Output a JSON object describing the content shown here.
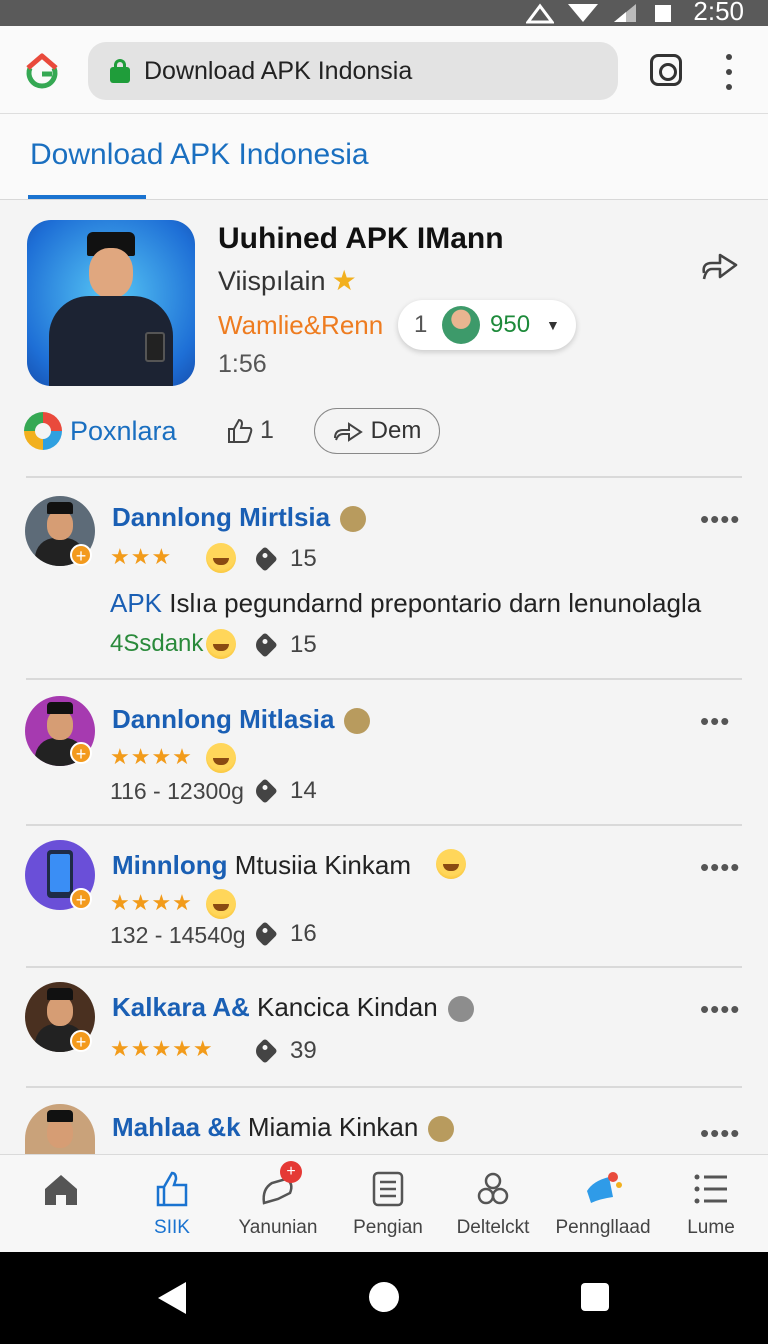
{
  "status_bar": {
    "time": "2:50"
  },
  "browser": {
    "url_title": "Download APK Indonsia"
  },
  "site": {
    "title": "Download APK Indonesia"
  },
  "app": {
    "name": "Uuhined APK IMann",
    "subtitle": "Viispılain",
    "developer": "Wamlie&Renn",
    "time": "1:56",
    "count_left": "1",
    "count_right": "950",
    "source_label": "Poxnlara",
    "like_count": "1",
    "dem_label": "Dem"
  },
  "reviews": [
    {
      "name": "Dannlong Mirtlsia",
      "stars": "★★★",
      "tag_count": "15",
      "text_prefix": "APK",
      "text": " Islıa pegundarnd prepontario darn lenunolagla",
      "green_text": "4Ssdank",
      "green_count": "15",
      "more": "••••"
    },
    {
      "name": "Dannlong Mitlasia",
      "stars": "★★★★",
      "meta": "116 - 12300g",
      "tag_count": "14",
      "more": "•••"
    },
    {
      "name_bold": "Minnlong",
      "name_plain": " Mtusiia Kinkam",
      "stars": "★★★★",
      "meta": "132 - 14540g",
      "tag_count": "16",
      "more": "••••"
    },
    {
      "name_bold": "Kalkara A&",
      "name_plain": " Kancica Kindan",
      "stars": "★★★★★",
      "tag_count": "39",
      "more": "••••"
    },
    {
      "name_bold": "Mahlaa &k",
      "name_plain": " Miamia Kinkan",
      "more": "••••"
    }
  ],
  "bottom_nav": [
    {
      "label": "",
      "icon": "home-icon"
    },
    {
      "label": "SIIK",
      "icon": "thumbs-up-icon",
      "active": true
    },
    {
      "label": "Yanunian",
      "icon": "chat-icon",
      "badge": "+"
    },
    {
      "label": "Pengian",
      "icon": "list-doc-icon"
    },
    {
      "label": "Deltelckt",
      "icon": "people-icon"
    },
    {
      "label": "Penngllaad",
      "icon": "megaphone-icon"
    },
    {
      "label": "Lume",
      "icon": "menu-icon"
    }
  ],
  "colors": {
    "accent": "#1a73d0",
    "link": "#1a5fb4",
    "orange": "#ee7c20",
    "green": "#1d8a3a",
    "star": "#f29b1a"
  }
}
